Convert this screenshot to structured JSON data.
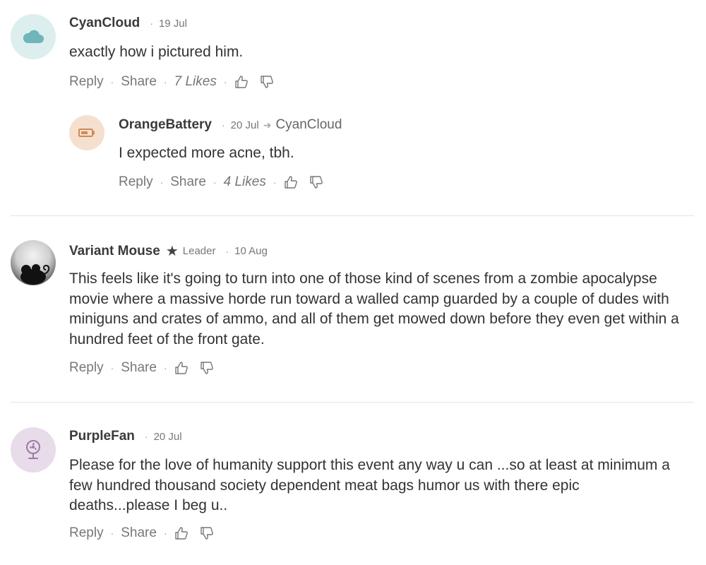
{
  "comments": [
    {
      "username": "CyanCloud",
      "date": "19 Jul",
      "body": "exactly how i pictured him.",
      "actions": {
        "reply": "Reply",
        "share": "Share",
        "likes": "7 Likes"
      },
      "avatar_color": "#dceeee",
      "icon_color": "#6fb5b9",
      "icon": "cloud-icon"
    },
    {
      "username": "OrangeBattery",
      "date": "20 Jul",
      "reply_to": "CyanCloud",
      "body": "I expected more acne, tbh.",
      "actions": {
        "reply": "Reply",
        "share": "Share",
        "likes": "4 Likes"
      },
      "avatar_color": "#f5e0cf",
      "icon_color": "#d08a55",
      "icon": "battery-icon"
    },
    {
      "username": "Variant Mouse",
      "badge": "Leader",
      "date": "10 Aug",
      "body": "This feels like it's going to turn into one of those kind of scenes from a zombie apocalypse movie where a massive horde run toward a walled camp guarded by a couple of dudes with miniguns and crates of ammo, and all of them get mowed down before they even get within a hundred feet of the front gate.",
      "actions": {
        "reply": "Reply",
        "share": "Share"
      },
      "icon": "mouse-avatar"
    },
    {
      "username": "PurpleFan",
      "date": "20 Jul",
      "body": "Please for the love of humanity support this event any way u can ...so at least at minimum a few hundred thousand society dependent meat bags humor us with there epic deaths...please I beg u..",
      "actions": {
        "reply": "Reply",
        "share": "Share"
      },
      "avatar_color": "#e8dcea",
      "icon_color": "#9b7aa3",
      "icon": "fan-icon"
    }
  ]
}
